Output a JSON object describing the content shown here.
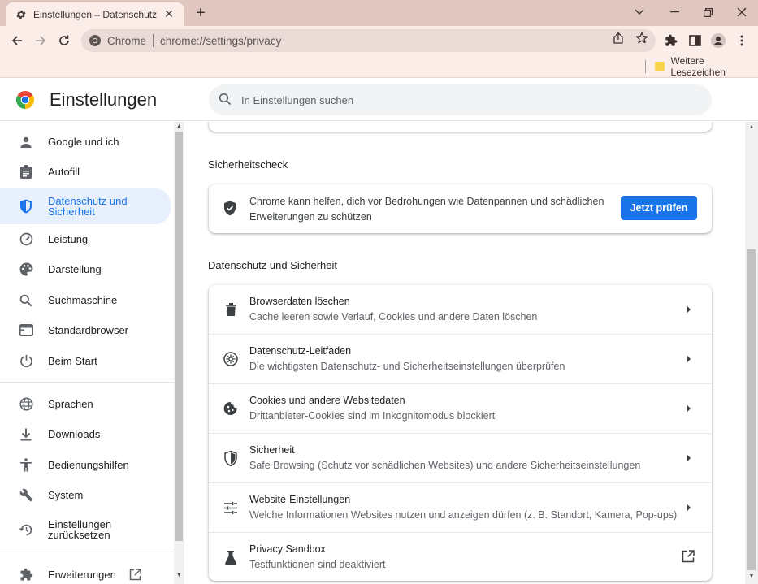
{
  "browser": {
    "tab_title": "Einstellungen – Datenschutz und",
    "new_tab_label": "+",
    "omnibox_scheme": "Chrome",
    "omnibox_url": "chrome://settings/privacy",
    "bookmark_folder": "Weitere Lesezeichen"
  },
  "header": {
    "title": "Einstellungen",
    "search_placeholder": "In Einstellungen suchen"
  },
  "sidebar": {
    "items": [
      {
        "label": "Google und ich",
        "icon": "person-icon"
      },
      {
        "label": "Autofill",
        "icon": "clipboard-icon"
      },
      {
        "label": "Datenschutz und Sicherheit",
        "icon": "shield-icon",
        "active": true
      },
      {
        "label": "Leistung",
        "icon": "speedometer-icon"
      },
      {
        "label": "Darstellung",
        "icon": "palette-icon"
      },
      {
        "label": "Suchmaschine",
        "icon": "search-icon"
      },
      {
        "label": "Standardbrowser",
        "icon": "browser-icon"
      },
      {
        "label": "Beim Start",
        "icon": "power-icon"
      },
      {
        "label": "Sprachen",
        "icon": "globe-icon"
      },
      {
        "label": "Downloads",
        "icon": "download-icon"
      },
      {
        "label": "Bedienungshilfen",
        "icon": "accessibility-icon"
      },
      {
        "label": "System",
        "icon": "wrench-icon"
      },
      {
        "label": "Einstellungen zurücksetzen",
        "icon": "restore-icon"
      },
      {
        "label": "Erweiterungen",
        "icon": "puzzle-icon"
      }
    ]
  },
  "safety_check": {
    "section_title": "Sicherheitscheck",
    "text": "Chrome kann helfen, dich vor Bedrohungen wie Datenpannen und schädlichen Erweiterungen zu schützen",
    "button_label": "Jetzt prüfen"
  },
  "privacy": {
    "section_title": "Datenschutz und Sicherheit",
    "rows": [
      {
        "title": "Browserdaten löschen",
        "subtitle": "Cache leeren sowie Verlauf, Cookies und andere Daten löschen",
        "icon": "trash-icon"
      },
      {
        "title": "Datenschutz-Leitfaden",
        "subtitle": "Die wichtigsten Datenschutz- und Sicherheitseinstellungen überprüfen",
        "icon": "compass-icon"
      },
      {
        "title": "Cookies und andere Websitedaten",
        "subtitle": "Drittanbieter-Cookies sind im Inkognitomodus blockiert",
        "icon": "cookie-icon"
      },
      {
        "title": "Sicherheit",
        "subtitle": "Safe Browsing (Schutz vor schädlichen Websites) und andere Sicherheitseinstellungen",
        "icon": "security-shield-icon"
      },
      {
        "title": "Website-Einstellungen",
        "subtitle": "Welche Informationen Websites nutzen und anzeigen dürfen (z. B. Standort, Kamera, Pop-ups)",
        "icon": "tune-icon"
      },
      {
        "title": "Privacy Sandbox",
        "subtitle": "Testfunktionen sind deaktiviert",
        "icon": "flask-icon"
      }
    ]
  },
  "colors": {
    "accent": "#1a73e8",
    "tabstrip": "#dfc7c0",
    "toolbar": "#fbeee9",
    "active_nav_bg": "#e8f0fe"
  }
}
